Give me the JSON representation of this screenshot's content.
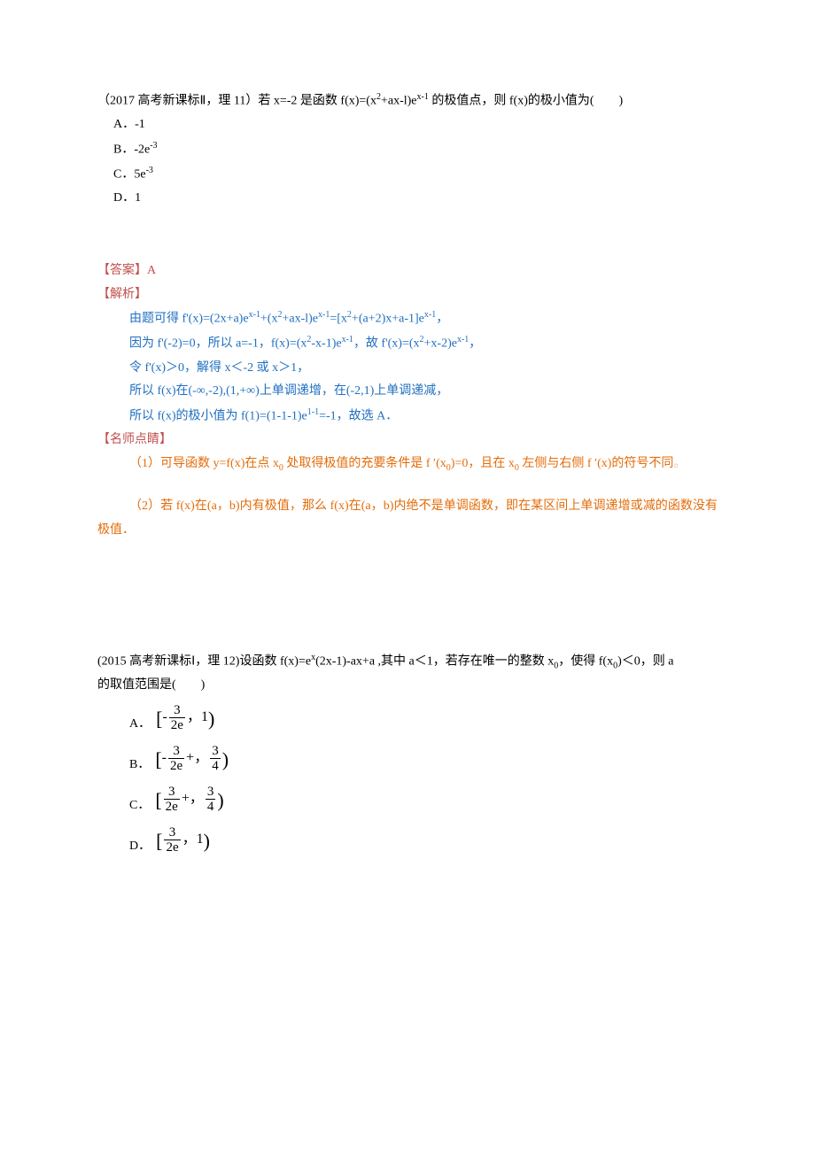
{
  "q1": {
    "stem_prefix": "（2017 高考新课标Ⅱ，理 11）若 x=-2 是函数 f(x)=(x",
    "stem_mid1": "+ax-l)e",
    "stem_mid2": " 的极值点，则 f(x)的极小值为(　　)",
    "opts": {
      "a": "A．-1",
      "b_pre": "B．-2e",
      "b_sup": "-3",
      "c_pre": "C．5e",
      "c_sup": "-3",
      "d": "D．1"
    }
  },
  "ans1": {
    "label": "【答案】A",
    "jiexi": "【解析】",
    "l1_a": "由题可得 f'(x)=(2x+a)e",
    "l1_b": "+(x",
    "l1_c": "+ax-l)e",
    "l1_d": "=[x",
    "l1_e": "+(a+2)x+a-1]e",
    "l1_f": "，",
    "l2_a": "因为 f'(-2)=0，所以 a=-1，f(x)=(x",
    "l2_b": "-x-1)e",
    "l2_c": "，故 f'(x)=(x",
    "l2_d": "+x-2)e",
    "l2_e": "，",
    "l3": "令 f'(x)＞0，解得 x＜-2 或 x＞1，",
    "l4": "所以 f(x)在(-∞,-2),(1,+∞)上单调递增，在(-2,1)上单调递减，",
    "l5_a": "所以 f(x)的极小值为 f(1)=(1-1-1)e",
    "l5_b": "=-1，故选 A．",
    "dj_label": "【名师点睛】",
    "dj1_a": "（1）可导函数 y=f(x)在点 x",
    "dj1_b": " 处取得极值的充要条件是 f ′(x",
    "dj1_c": ")=0，且在 x",
    "dj1_d": " 左侧与右侧 f ′(x)的符号不同",
    "dj1_e": "。",
    "dj2": "（2）若 f(x)在(a，b)内有极值，那么 f(x)在(a，b)内绝不是单调函数，即在某区间上单调递增或减的函数没有极值．"
  },
  "q2": {
    "stem_a": "(2015 高考新课标Ⅰ，理 12)设函数 f(x)=e",
    "stem_b": "(2x-1)-ax+a ,其中 a＜1，若存在唯一的整数 x",
    "stem_c": "，使得 f(x",
    "stem_d": ")＜0，则 a",
    "stem_e": "的取值范围是(　　)",
    "letters": {
      "a": "A．",
      "b": "B．",
      "c": "C．",
      "d": "D．"
    },
    "frac": {
      "three": "3",
      "twoe": "2e",
      "four": "4"
    },
    "one": "1"
  },
  "sup": {
    "two": "2",
    "xminus1": "x-1",
    "oneminus1": "1-1",
    "x": "x"
  },
  "sub0": "0"
}
